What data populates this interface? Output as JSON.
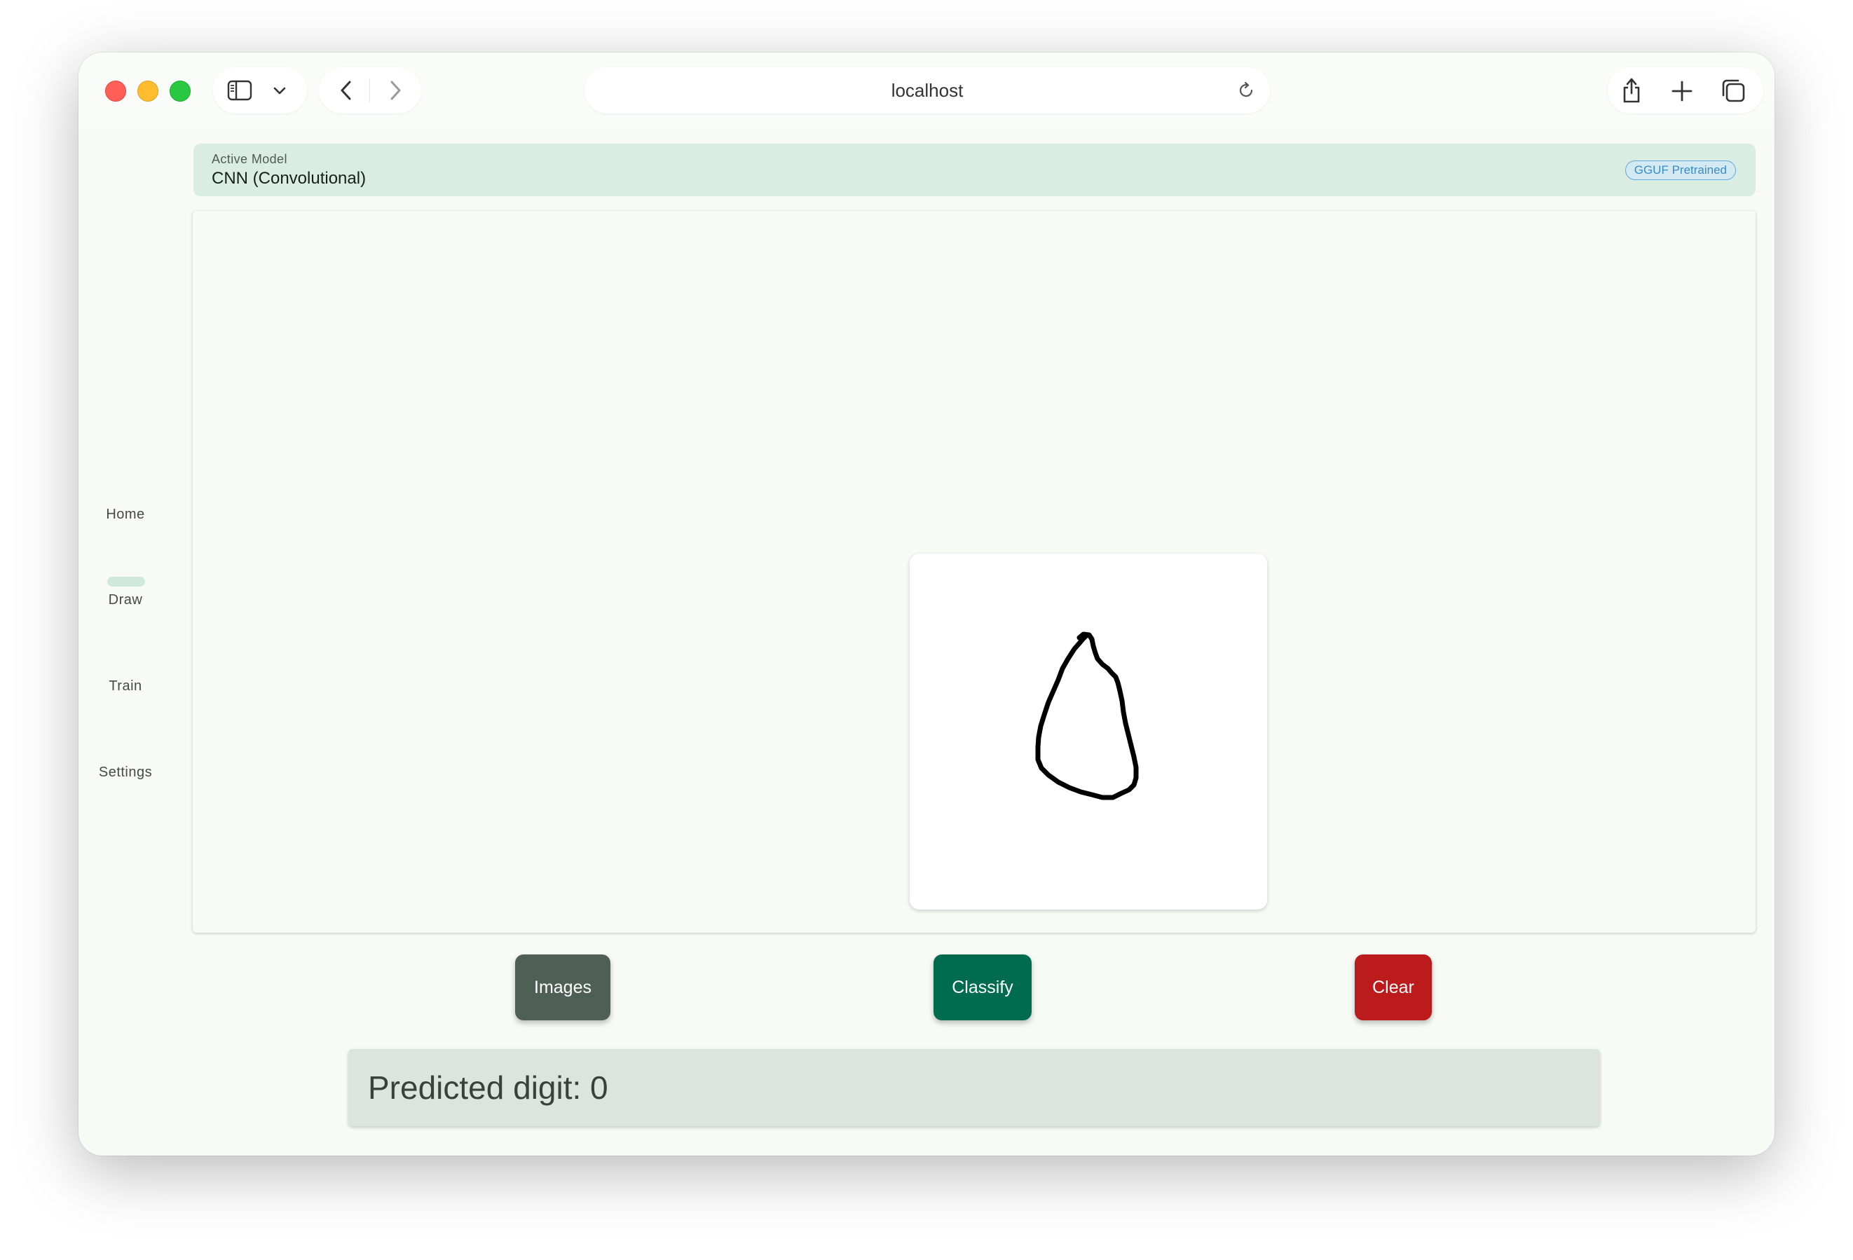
{
  "browser": {
    "url": "localhost",
    "icons": {
      "sidebar": "sidebar-icon",
      "chevron": "chevron-down-icon",
      "back": "back-icon",
      "forward": "forward-icon",
      "reload": "reload-icon",
      "share": "share-icon",
      "new_tab": "plus-icon",
      "tabs": "tabs-overview-icon"
    }
  },
  "sidenav": {
    "items": [
      {
        "label": "Home",
        "active": false
      },
      {
        "label": "Draw",
        "active": true
      },
      {
        "label": "Train",
        "active": false
      },
      {
        "label": "Settings",
        "active": false
      }
    ]
  },
  "model": {
    "label": "Active Model",
    "name": "CNN (Convolutional)",
    "badge": "GGUF Pretrained"
  },
  "actions": {
    "images_label": "Images",
    "classify_label": "Classify",
    "clear_label": "Clear"
  },
  "result": {
    "text": "Predicted digit: 0"
  },
  "colors": {
    "accent": "#006c4f",
    "danger": "#bb1b1b",
    "secondary": "#4e5f55",
    "banner": "#d9ede2"
  }
}
